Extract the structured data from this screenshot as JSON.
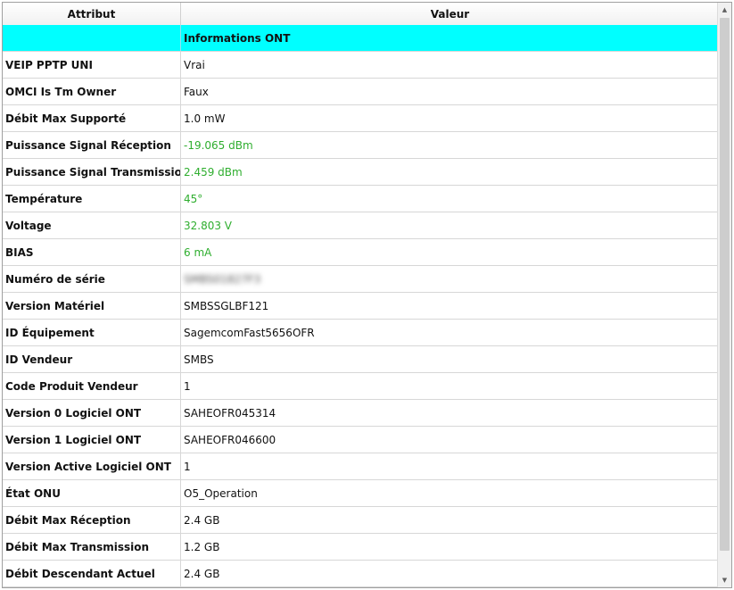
{
  "table": {
    "headers": {
      "attribute": "Attribut",
      "value": "Valeur"
    },
    "section_label": "Informations ONT",
    "rows": [
      {
        "attribute": "VEIP PPTP UNI",
        "value": "Vrai",
        "style": "normal"
      },
      {
        "attribute": "OMCI Is Tm Owner",
        "value": "Faux",
        "style": "normal"
      },
      {
        "attribute": "Débit Max Supporté",
        "value": "1.0 mW",
        "style": "normal"
      },
      {
        "attribute": "Puissance Signal Réception",
        "value": "-19.065 dBm",
        "style": "green"
      },
      {
        "attribute": "Puissance Signal Transmission",
        "value": "2.459 dBm",
        "style": "green"
      },
      {
        "attribute": "Température",
        "value": "45°",
        "style": "green"
      },
      {
        "attribute": "Voltage",
        "value": "32.803 V",
        "style": "green"
      },
      {
        "attribute": "BIAS",
        "value": "6 mA",
        "style": "green"
      },
      {
        "attribute": "Numéro de série",
        "value": "SMBS01827F3",
        "style": "blurred"
      },
      {
        "attribute": "Version Matériel",
        "value": "SMBSSGLBF121",
        "style": "normal"
      },
      {
        "attribute": "ID Équipement",
        "value": "SagemcomFast5656OFR",
        "style": "normal"
      },
      {
        "attribute": "ID Vendeur",
        "value": "SMBS",
        "style": "normal"
      },
      {
        "attribute": "Code Produit Vendeur",
        "value": "1",
        "style": "normal"
      },
      {
        "attribute": "Version 0 Logiciel ONT",
        "value": "SAHEOFR045314",
        "style": "normal"
      },
      {
        "attribute": "Version 1 Logiciel ONT",
        "value": "SAHEOFR046600",
        "style": "normal"
      },
      {
        "attribute": "Version Active Logiciel ONT",
        "value": "1",
        "style": "normal"
      },
      {
        "attribute": "État ONU",
        "value": "O5_Operation",
        "style": "normal"
      },
      {
        "attribute": "Débit Max Réception",
        "value": "2.4 GB",
        "style": "normal"
      },
      {
        "attribute": "Débit Max Transmission",
        "value": "1.2 GB",
        "style": "normal"
      },
      {
        "attribute": "Débit Descendant Actuel",
        "value": "2.4 GB",
        "style": "normal"
      }
    ]
  },
  "colors": {
    "section_background": "#00ffff",
    "good_value": "#2fae2f"
  },
  "scrollbar": {
    "up_icon": "triangle-up-icon",
    "down_icon": "triangle-down-icon"
  }
}
